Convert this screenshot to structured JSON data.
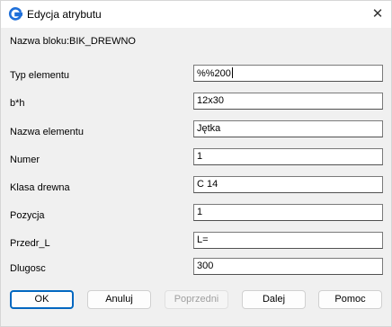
{
  "window": {
    "title": "Edycja atrybutu"
  },
  "block_name_label": "Nazwa bloku:BIK_DREWNO",
  "attributes": [
    {
      "label": "Typ elementu",
      "value": "%%200"
    },
    {
      "label": "b*h",
      "value": "12x30"
    },
    {
      "label": "Nazwa elementu",
      "value": "Jętka"
    },
    {
      "label": "Numer",
      "value": "1"
    },
    {
      "label": "Klasa drewna",
      "value": "C 14"
    },
    {
      "label": "Pozycja",
      "value": "1"
    },
    {
      "label": "Przedr_L",
      "value": "L="
    },
    {
      "label": "Dlugosc",
      "value": "300"
    }
  ],
  "buttons": {
    "ok": "OK",
    "cancel": "Anuluj",
    "previous": "Poprzedni",
    "next": "Dalej",
    "help": "Pomoc"
  },
  "colors": {
    "accent": "#0067c0",
    "icon_blue": "#1e6fd9"
  }
}
